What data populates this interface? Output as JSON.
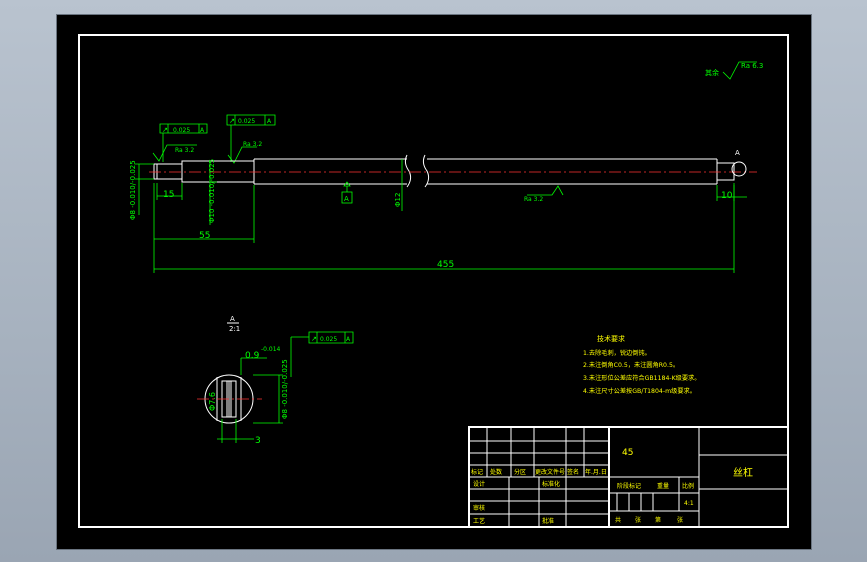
{
  "drawing": {
    "roughness_symbol": {
      "prefix": "其余",
      "value": "Ra 6.3"
    },
    "tolerance_frames": [
      {
        "symbol": "↗",
        "value": "0.025",
        "datum": "A"
      },
      {
        "symbol": "↗",
        "value": "0.025",
        "datum": "A"
      },
      {
        "symbol": "↗",
        "value": "0.025",
        "datum": "A"
      }
    ],
    "local_roughness": [
      "Ra 3.2",
      "Ra 3.2",
      "Ra 3.2"
    ],
    "datum_label": "A",
    "dimensions": {
      "total_length": "455",
      "len_55": "55",
      "len_15": "15",
      "len_10": "10",
      "dia_left": "Φ8 -0.010/-0.025",
      "dia_second": "Φ10 -0.010/-0.025",
      "dia_main": "Φ12"
    },
    "section": {
      "label": "A",
      "scale": "2:1",
      "depth": "0.9",
      "depth_tol": "-0.014",
      "width": "3",
      "dia_inner": "Φ7.6",
      "dia_outer": "Φ8 -0.010/-0.025"
    },
    "tech_requirements": {
      "title": "技术要求",
      "items": [
        "1.去除毛刺，锐边倒钝。",
        "2.未注倒角C0.5，未注圆角R0.5。",
        "3.未注形位公差应符合GB1184-K级要求。",
        "4.未注尺寸公差按GB/T1804-m级要求。"
      ]
    }
  },
  "title_block": {
    "material": "45",
    "part_name": "丝杠",
    "header_cells": [
      "标记",
      "处数",
      "分区",
      "更改文件号",
      "签名",
      "年.月.日"
    ],
    "design_label": "设计",
    "standardize_label": "标准化",
    "review_label": "审核",
    "process_label": "工艺",
    "approve_label": "批准",
    "stage_label": "阶段标记",
    "weight_label": "重量",
    "scale_label": "比例",
    "scale_value": "4:1",
    "sheet_cells": [
      "共",
      "张",
      "第",
      "张"
    ]
  },
  "colors": {
    "background": "#000000",
    "line": "#ffffff",
    "dimension": "#00ff00",
    "centerline": "#ff3333",
    "text_yellow": "#ffff00"
  }
}
